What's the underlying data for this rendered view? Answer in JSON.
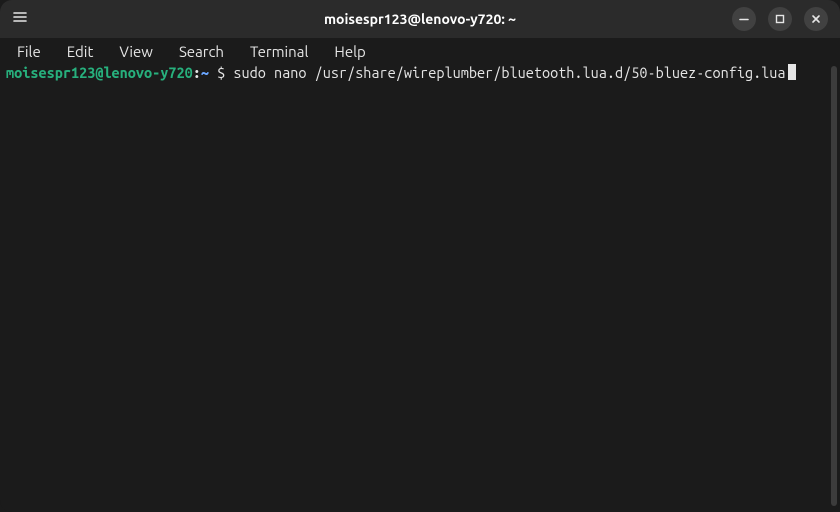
{
  "colors": {
    "bg": "#1b1b1b",
    "titlebar": "#2b2b2b",
    "text": "#e6e6e6",
    "prompt_user": "#27b07d",
    "prompt_path": "#6aa6ff",
    "win_btn": "#414141"
  },
  "titlebar": {
    "menu_button_icon": "hamburger-icon",
    "title": "moisespr123@lenovo-y720: ~",
    "controls": {
      "minimize_icon": "minimize-icon",
      "maximize_icon": "maximize-icon",
      "close_icon": "close-icon"
    }
  },
  "menubar": {
    "items": [
      "File",
      "Edit",
      "View",
      "Search",
      "Terminal",
      "Help"
    ]
  },
  "terminal": {
    "prompt": {
      "user_host": "moisespr123@lenovo-y720",
      "separator": ":",
      "path": "~",
      "symbol": "$"
    },
    "command": "sudo nano /usr/share/wireplumber/bluetooth.lua.d/50-bluez-config.lua"
  }
}
